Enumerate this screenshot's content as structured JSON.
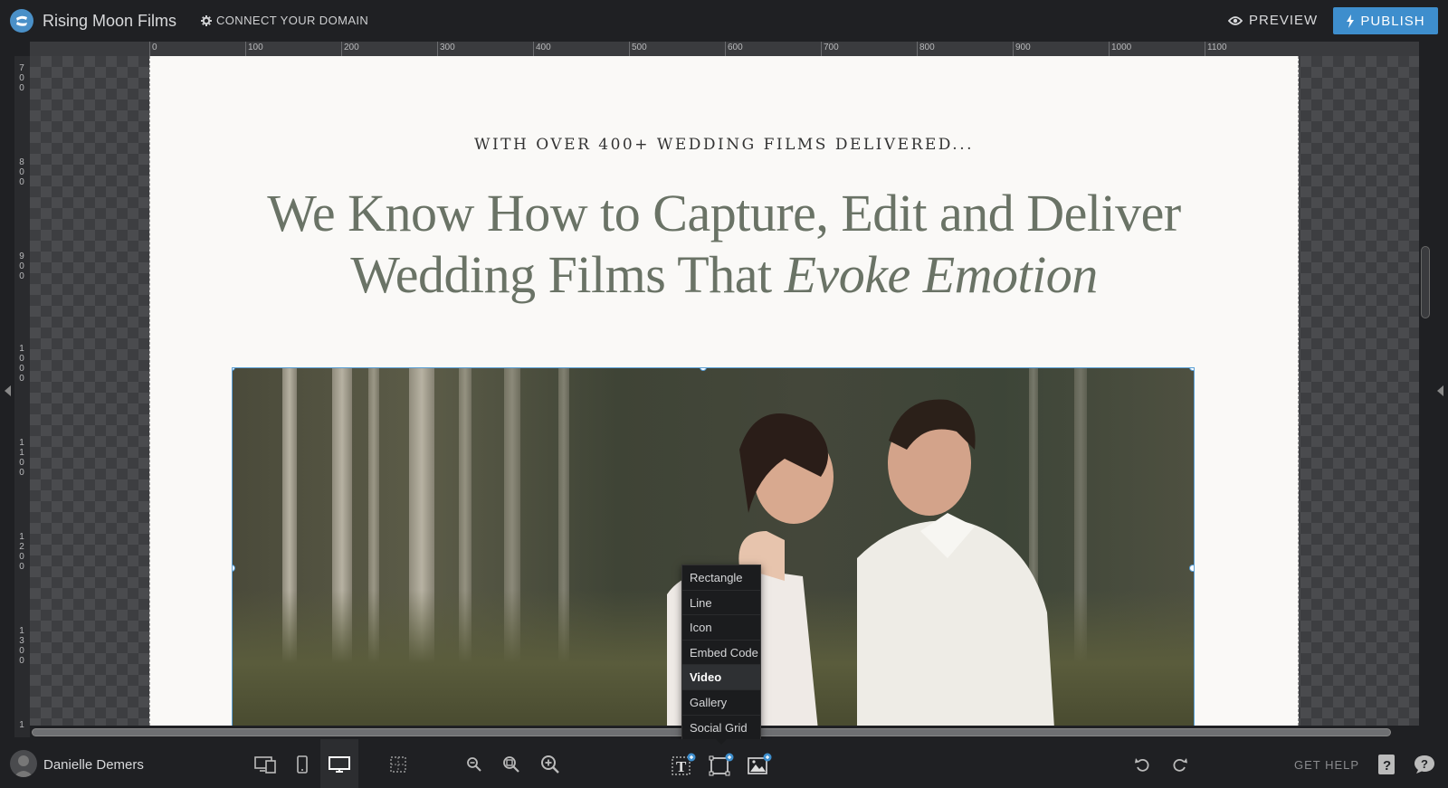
{
  "header": {
    "site_name": "Rising Moon Films",
    "connect_label": "CONNECT YOUR DOMAIN",
    "preview_label": "PREVIEW",
    "publish_label": "PUBLISH"
  },
  "ruler": {
    "top_labels": [
      "0",
      "100",
      "200",
      "300",
      "400",
      "500",
      "600",
      "700",
      "800",
      "900",
      "1000",
      "1100"
    ],
    "left_labels": [
      "700",
      "800",
      "900",
      "1000",
      "1100",
      "1200",
      "1300",
      "1"
    ]
  },
  "page": {
    "eyebrow": "WITH OVER 400+ WEDDING FILMS DELIVERED...",
    "headline_line1": "We Know How to Capture, Edit and Deliver",
    "headline_line2_plain": "Wedding Films That ",
    "headline_line2_italic": "Evoke Emotion"
  },
  "add_menu": {
    "items": [
      "Rectangle",
      "Line",
      "Icon",
      "Embed Code",
      "Video",
      "Gallery",
      "Social Grid"
    ],
    "active": "Video"
  },
  "footer": {
    "username": "Danielle Demers",
    "get_help_label": "GET HELP"
  },
  "colors": {
    "accent": "#3e8ecd",
    "headline": "#6a7366",
    "selection": "#5a9fd6"
  }
}
